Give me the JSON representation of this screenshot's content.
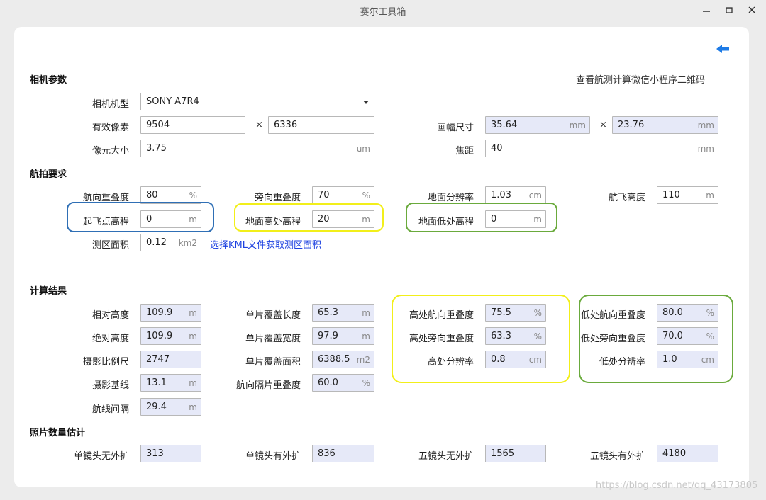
{
  "window": {
    "title": "赛尔工具箱"
  },
  "header": {
    "qr_link": "查看航测计算微信小程序二维码"
  },
  "camera": {
    "section_title": "相机参数",
    "model": {
      "label": "相机机型",
      "value": "SONY A7R4"
    },
    "pixels": {
      "label": "有效像素",
      "width": "9504",
      "times": "×",
      "height": "6336"
    },
    "frame": {
      "label": "画幅尺寸",
      "width": "35.64",
      "width_unit": "mm",
      "times": "×",
      "height": "23.76",
      "height_unit": "mm"
    },
    "pixel_size": {
      "label": "像元大小",
      "value": "3.75",
      "unit": "um"
    },
    "focal": {
      "label": "焦距",
      "value": "40",
      "unit": "mm"
    }
  },
  "flight": {
    "section_title": "航拍要求",
    "fwd_overlap": {
      "label": "航向重叠度",
      "value": "80",
      "unit": "%"
    },
    "side_overlap": {
      "label": "旁向重叠度",
      "value": "70",
      "unit": "%"
    },
    "gsd": {
      "label": "地面分辨率",
      "value": "1.03",
      "unit": "cm"
    },
    "altitude": {
      "label": "航飞高度",
      "value": "110",
      "unit": "m"
    },
    "takeoff_elev": {
      "label": "起飞点高程",
      "value": "0",
      "unit": "m"
    },
    "ground_high": {
      "label": "地面高处高程",
      "value": "20",
      "unit": "m"
    },
    "ground_low": {
      "label": "地面低处高程",
      "value": "0",
      "unit": "m"
    },
    "area": {
      "label": "测区面积",
      "value": "0.12",
      "unit": "km2"
    },
    "kml_link": "选择KML文件获取测区面积"
  },
  "results": {
    "section_title": "计算结果",
    "rel_height": {
      "label": "相对高度",
      "value": "109.9",
      "unit": "m"
    },
    "abs_height": {
      "label": "绝对高度",
      "value": "109.9",
      "unit": "m"
    },
    "scale": {
      "label": "摄影比例尺",
      "value": "2747"
    },
    "baseline": {
      "label": "摄影基线",
      "value": "13.1",
      "unit": "m"
    },
    "line_spacing": {
      "label": "航线间隔",
      "value": "29.4",
      "unit": "m"
    },
    "cover_len": {
      "label": "单片覆盖长度",
      "value": "65.3",
      "unit": "m"
    },
    "cover_wid": {
      "label": "单片覆盖宽度",
      "value": "97.9",
      "unit": "m"
    },
    "cover_area": {
      "label": "单片覆盖面积",
      "value": "6388.5",
      "unit": "m2"
    },
    "skip_overlap": {
      "label": "航向隔片重叠度",
      "value": "60.0",
      "unit": "%"
    },
    "high_fwd": {
      "label": "高处航向重叠度",
      "value": "75.5",
      "unit": "%"
    },
    "high_side": {
      "label": "高处旁向重叠度",
      "value": "63.3",
      "unit": "%"
    },
    "high_gsd": {
      "label": "高处分辨率",
      "value": "0.8",
      "unit": "cm"
    },
    "low_fwd": {
      "label": "低处航向重叠度",
      "value": "80.0",
      "unit": "%"
    },
    "low_side": {
      "label": "低处旁向重叠度",
      "value": "70.0",
      "unit": "%"
    },
    "low_gsd": {
      "label": "低处分辨率",
      "value": "1.0",
      "unit": "cm"
    }
  },
  "photos": {
    "section_title": "照片数量估计",
    "single_no": {
      "label": "单镜头无外扩",
      "value": "313"
    },
    "single_yes": {
      "label": "单镜头有外扩",
      "value": "836"
    },
    "five_no": {
      "label": "五镜头无外扩",
      "value": "1565"
    },
    "five_yes": {
      "label": "五镜头有外扩",
      "value": "4180"
    }
  },
  "watermark": "https://blog.csdn.net/qq_43173805",
  "colors": {
    "back_arrow": "#1e7be6",
    "ring_blue": "#2f6fb5",
    "ring_yellow": "#f2ef1a",
    "ring_green": "#6aaa3c",
    "readonly_bg": "#e6e9f8",
    "link": "#1a3fe0"
  }
}
